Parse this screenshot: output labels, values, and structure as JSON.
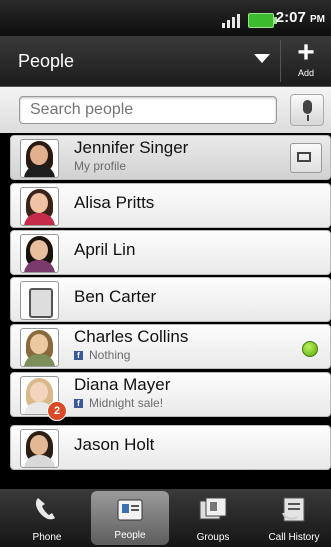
{
  "status": {
    "time": "2:07",
    "ampm": "PM"
  },
  "header": {
    "title": "People",
    "add_label": "Add"
  },
  "search": {
    "placeholder": "Search people"
  },
  "contacts": [
    {
      "name": "Jennifer Singer",
      "subtitle": "My profile"
    },
    {
      "name": "Alisa Pritts"
    },
    {
      "name": "April Lin"
    },
    {
      "name": "Ben Carter"
    },
    {
      "name": "Charles Collins",
      "subtitle": "Nothing",
      "status": "online"
    },
    {
      "name": "Diana Mayer",
      "subtitle": "Midnight sale!",
      "badge": "2"
    },
    {
      "name": "Jason Holt"
    }
  ],
  "tabs": [
    {
      "label": "Phone",
      "icon": "phone-icon"
    },
    {
      "label": "People",
      "icon": "people-icon",
      "active": true
    },
    {
      "label": "Groups",
      "icon": "groups-icon"
    },
    {
      "label": "Call History",
      "icon": "call-history-icon"
    }
  ],
  "colors": {
    "online": "#5aa60f",
    "badge": "#d94a25",
    "facebook": "#3b5998"
  }
}
